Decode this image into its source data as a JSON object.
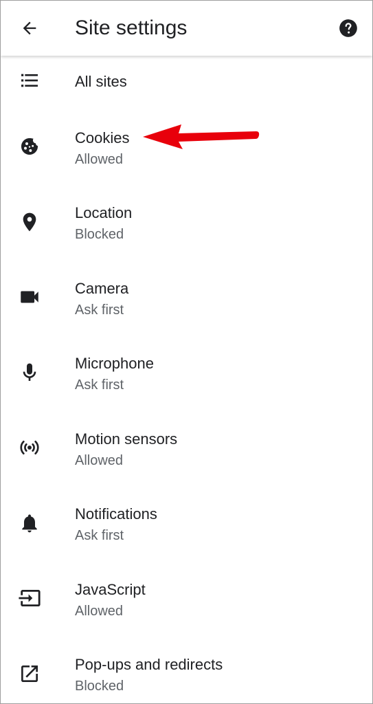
{
  "appbar": {
    "back_icon": "arrow-back-icon",
    "title": "Site settings",
    "help_icon": "help-icon"
  },
  "items": [
    {
      "icon": "list-icon",
      "label": "All sites",
      "sub": ""
    },
    {
      "icon": "cookie-icon",
      "label": "Cookies",
      "sub": "Allowed"
    },
    {
      "icon": "location-pin-icon",
      "label": "Location",
      "sub": "Blocked"
    },
    {
      "icon": "videocam-icon",
      "label": "Camera",
      "sub": "Ask first"
    },
    {
      "icon": "mic-icon",
      "label": "Microphone",
      "sub": "Ask first"
    },
    {
      "icon": "motion-sensors-icon",
      "label": "Motion sensors",
      "sub": "Allowed"
    },
    {
      "icon": "bell-icon",
      "label": "Notifications",
      "sub": "Ask first"
    },
    {
      "icon": "javascript-icon",
      "label": "JavaScript",
      "sub": "Allowed"
    },
    {
      "icon": "open-external-icon",
      "label": "Pop-ups and redirects",
      "sub": "Blocked"
    }
  ],
  "annotation": {
    "color": "#e8000b"
  }
}
